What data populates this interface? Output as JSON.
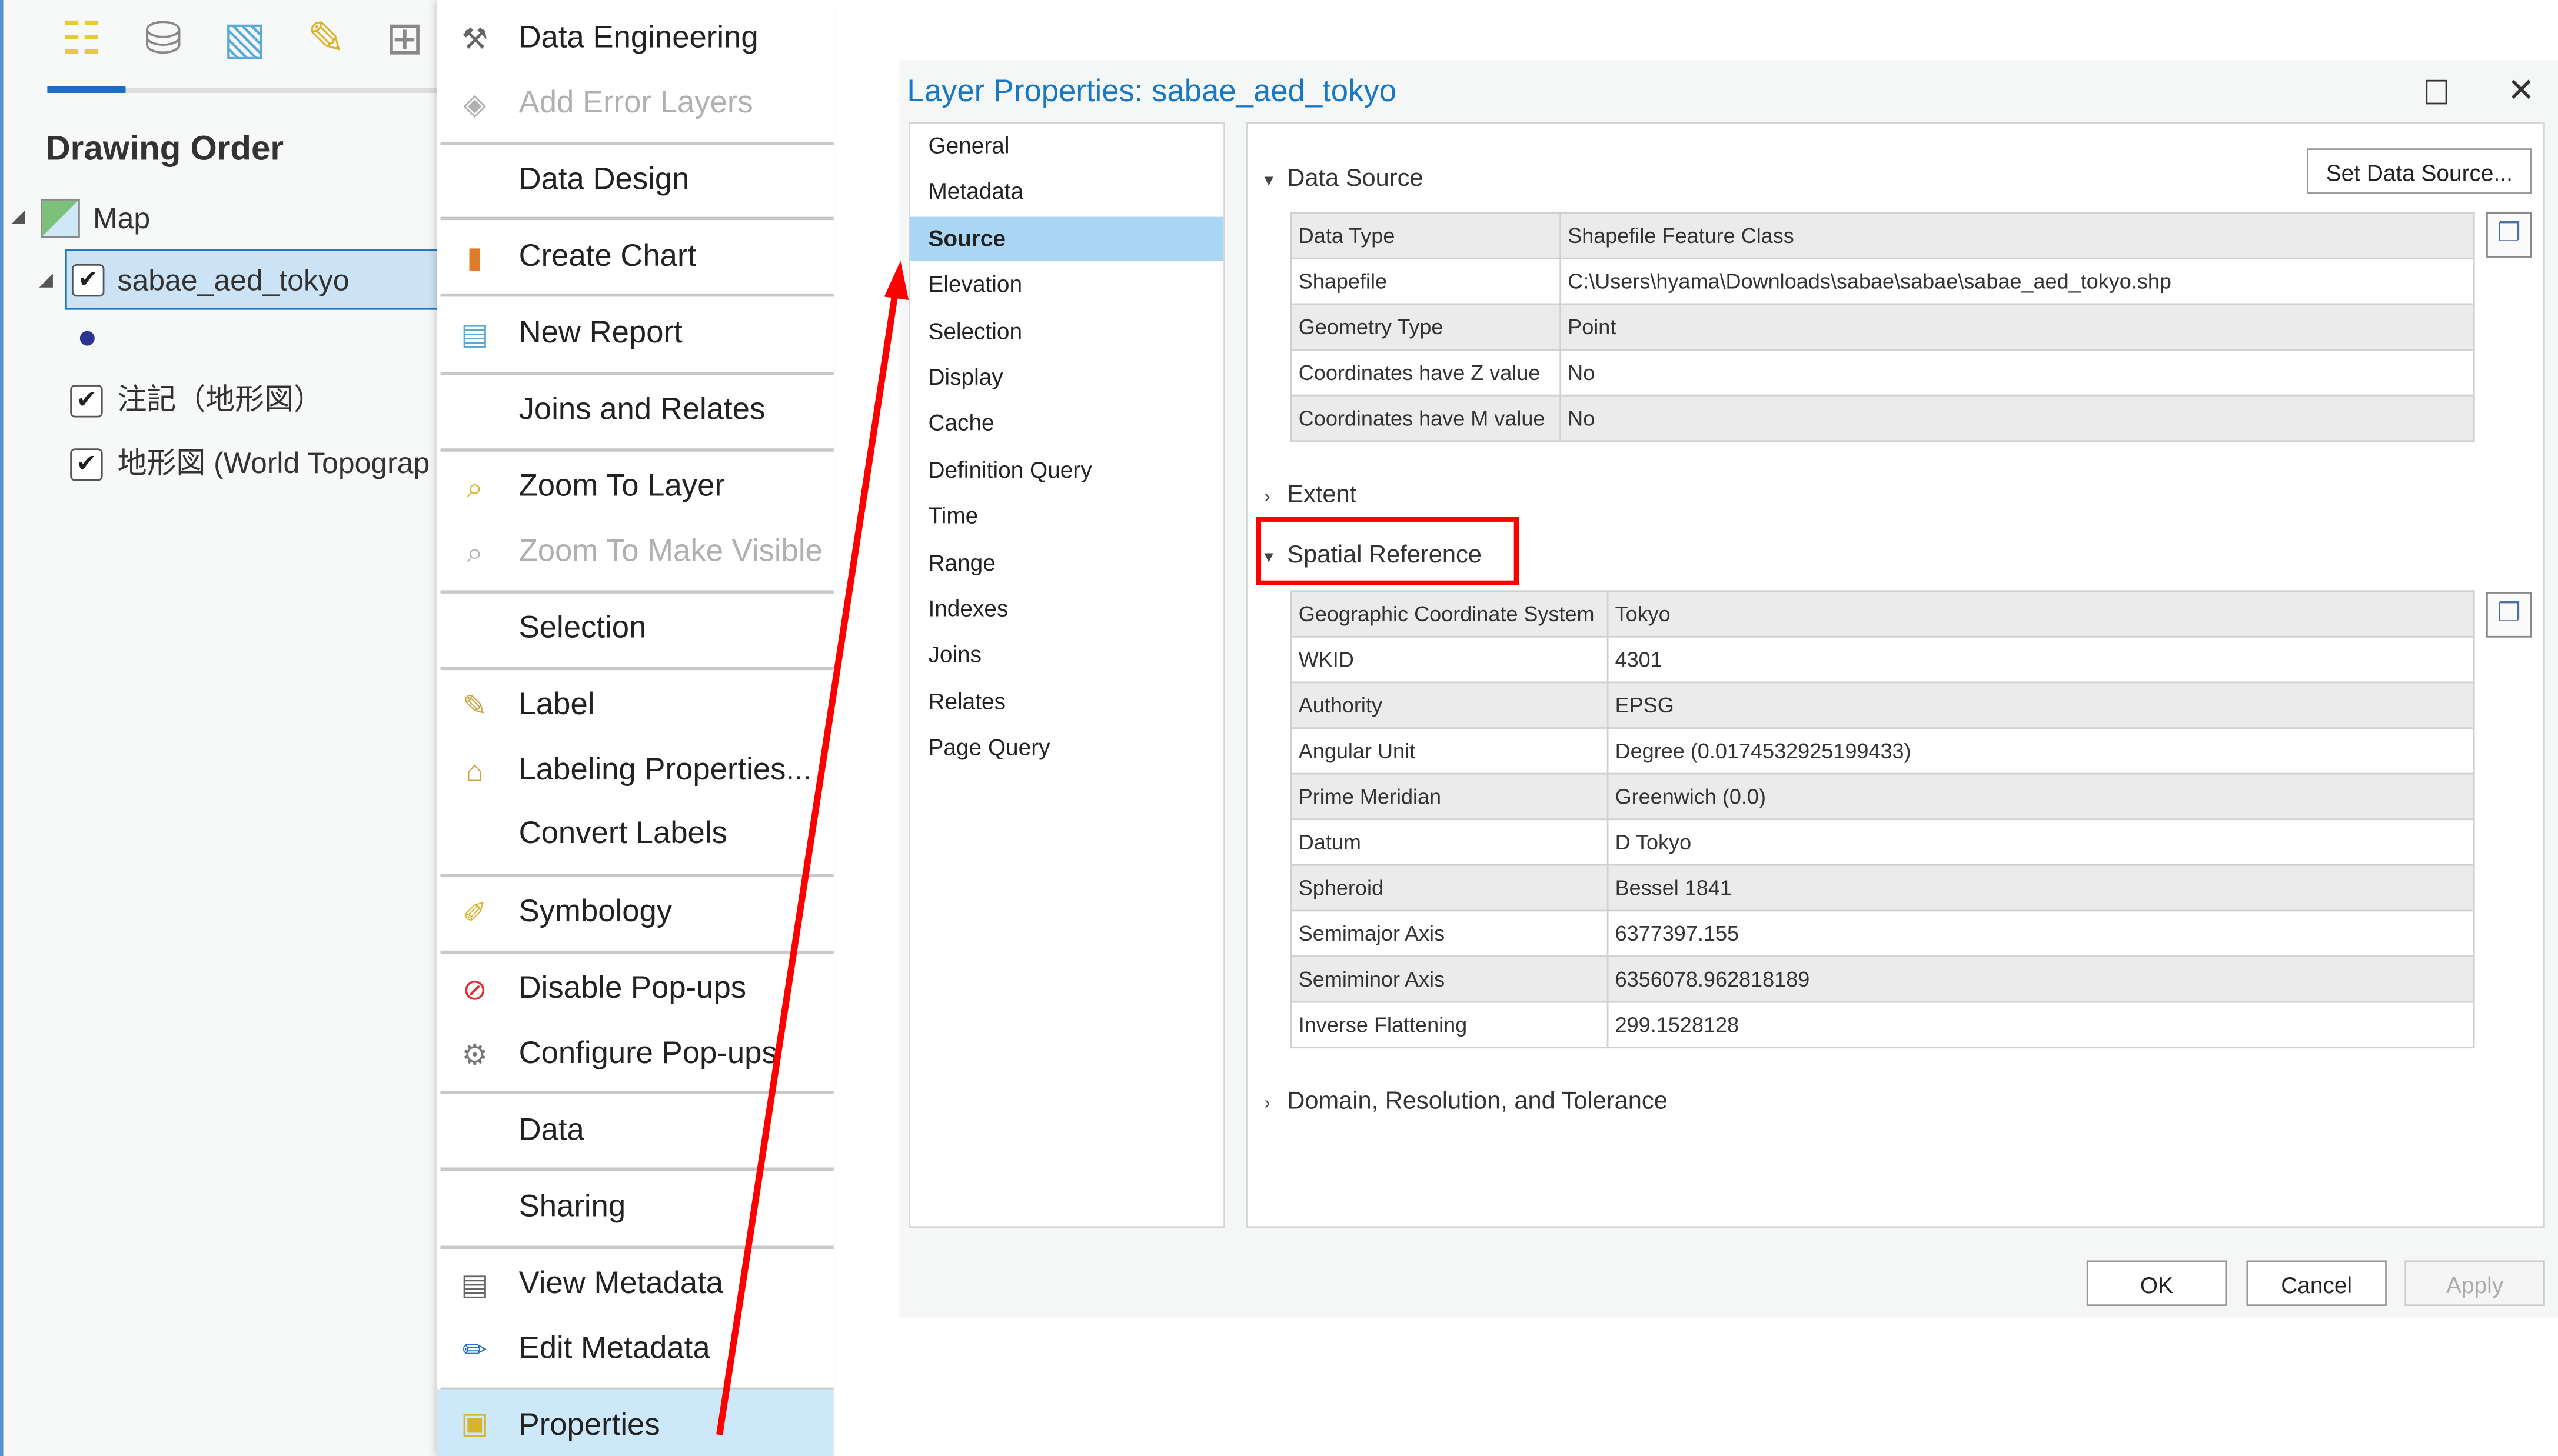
{
  "left_panel": {
    "toolbar_icons": [
      "list-by-drawing-order-icon",
      "list-by-source-icon",
      "list-by-selection-icon",
      "list-by-editing-icon",
      "list-by-snapping-icon"
    ],
    "title": "Drawing Order",
    "tree": {
      "map": "Map",
      "layers": [
        {
          "label": "sabae_aed_tokyo",
          "checked": true,
          "selected": true
        },
        {
          "label": "注記（地形図）",
          "checked": true
        },
        {
          "label": "地形図 (World Topograp",
          "checked": true
        }
      ],
      "symbol_color": "#2b3590"
    }
  },
  "context_menu": {
    "items": [
      {
        "label": "Data Engineering",
        "icon": "data-engineering-icon"
      },
      {
        "label": "Add Error Layers",
        "icon": "error-layers-icon",
        "disabled": true
      },
      {
        "label": "Data Design",
        "icon": ""
      },
      {
        "label": "Create Chart",
        "icon": "chart-icon"
      },
      {
        "label": "New Report",
        "icon": "report-icon"
      },
      {
        "label": "Joins and Relates",
        "icon": ""
      },
      {
        "label": "Zoom To Layer",
        "icon": "zoom-layer-icon"
      },
      {
        "label": "Zoom To Make Visible",
        "icon": "zoom-visible-icon",
        "disabled": true
      },
      {
        "label": "Selection",
        "icon": ""
      },
      {
        "label": "Label",
        "icon": "label-icon"
      },
      {
        "label": "Labeling Properties...",
        "icon": "labeling-properties-icon"
      },
      {
        "label": "Convert Labels",
        "icon": ""
      },
      {
        "label": "Symbology",
        "icon": "symbology-icon"
      },
      {
        "label": "Disable Pop-ups",
        "icon": "disable-popups-icon"
      },
      {
        "label": "Configure Pop-ups",
        "icon": "configure-popups-icon"
      },
      {
        "label": "Data",
        "icon": ""
      },
      {
        "label": "Sharing",
        "icon": ""
      },
      {
        "label": "View Metadata",
        "icon": "view-metadata-icon"
      },
      {
        "label": "Edit Metadata",
        "icon": "edit-metadata-icon"
      },
      {
        "label": "Properties",
        "icon": "properties-icon",
        "highlighted": true
      }
    ]
  },
  "dialog": {
    "title": "Layer Properties: sabae_aed_tokyo",
    "nav": [
      "General",
      "Metadata",
      "Source",
      "Elevation",
      "Selection",
      "Display",
      "Cache",
      "Definition Query",
      "Time",
      "Range",
      "Indexes",
      "Joins",
      "Relates",
      "Page Query"
    ],
    "nav_selected": "Source",
    "data_source": {
      "header": "Data Source",
      "set_button": "Set Data Source...",
      "rows": [
        [
          "Data Type",
          "Shapefile Feature Class"
        ],
        [
          "Shapefile",
          "C:\\Users\\hyama\\Downloads\\sabae\\sabae\\sabae_aed_tokyo.shp"
        ],
        [
          "Geometry Type",
          "Point"
        ],
        [
          "Coordinates have Z value",
          "No"
        ],
        [
          "Coordinates have M value",
          "No"
        ]
      ]
    },
    "extent_header": "Extent",
    "spatial_reference": {
      "header": "Spatial Reference",
      "rows": [
        [
          "Geographic Coordinate System",
          "Tokyo"
        ],
        [
          "WKID",
          "4301"
        ],
        [
          "Authority",
          "EPSG"
        ],
        [
          "Angular Unit",
          "Degree (0.0174532925199433)"
        ],
        [
          "Prime Meridian",
          "Greenwich (0.0)"
        ],
        [
          "Datum",
          "D Tokyo"
        ],
        [
          "Spheroid",
          "Bessel 1841"
        ],
        [
          "Semimajor Axis",
          "6377397.155"
        ],
        [
          "Semiminor Axis",
          "6356078.962818189"
        ],
        [
          "Inverse Flattening",
          "299.1528128"
        ]
      ]
    },
    "domain_header": "Domain, Resolution, and Tolerance",
    "buttons": {
      "ok": "OK",
      "cancel": "Cancel",
      "apply": "Apply"
    }
  },
  "annotation_color": "#ff0000"
}
